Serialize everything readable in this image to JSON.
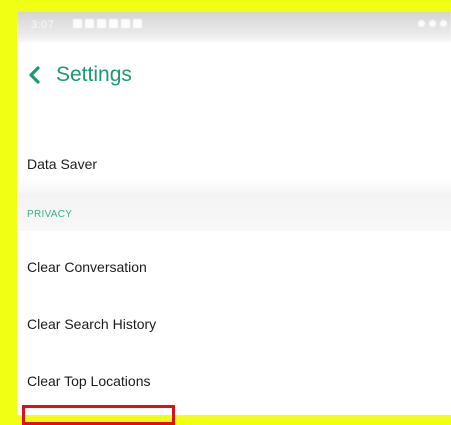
{
  "status_bar": {
    "time": "3:07"
  },
  "header": {
    "title": "Settings",
    "back_icon": "chevron-left-icon"
  },
  "rows": {
    "data_saver": "Data Saver",
    "privacy_section": "PRIVACY",
    "clear_conversation": "Clear Conversation",
    "clear_search_history": "Clear Search History",
    "clear_top_locations": "Clear Top Locations"
  },
  "colors": {
    "accent": "#1a9a72",
    "section_header": "#37b08a",
    "frame_border": "#f0ff14",
    "highlight": "#e01010"
  }
}
